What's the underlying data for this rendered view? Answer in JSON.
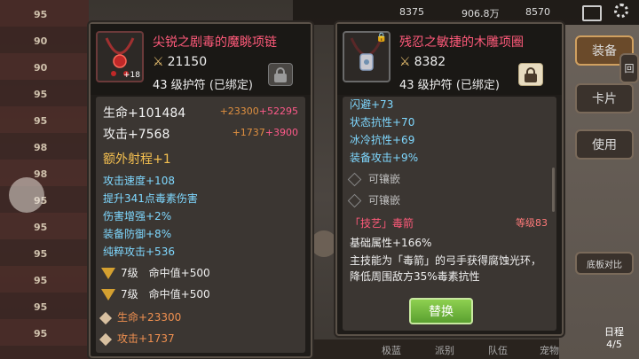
{
  "background": {
    "rank_rows": [
      "95",
      "90",
      "90",
      "95",
      "95",
      "98",
      "98",
      "95",
      "95",
      "95",
      "95",
      "95",
      "95"
    ],
    "top_stats": [
      "8375",
      "906.8万",
      "8570"
    ],
    "right_buttons": [
      "装备",
      "回",
      "卡片",
      "使用",
      "底板对比"
    ],
    "schedule": {
      "label": "日程",
      "progress": "4/5"
    },
    "bottom_tabs": [
      "极蓝",
      "派别",
      "队伍",
      "宠物"
    ]
  },
  "left_item": {
    "name": "尖锐之剧毒的魔眺项链",
    "enhance": "+18",
    "power": "21150",
    "level_text": "43 级护符",
    "bound_text": "(已绑定)",
    "stats": [
      {
        "label": "生命+101484",
        "extra1": "+23300",
        "extra2": "+52295"
      },
      {
        "label": "攻击+7568",
        "extra1": "+1737",
        "extra2": "+3900"
      }
    ],
    "special": "额外射程+1",
    "attrs": [
      "攻击速度+108",
      "提升341点毒素伤害",
      "伤害增强+2%",
      "装备防御+8%",
      "纯粹攻击+536"
    ],
    "gems": [
      {
        "level": "7级",
        "text": "命中值+500"
      },
      {
        "level": "7级",
        "text": "命中值+500"
      }
    ],
    "enhancements": [
      "生命+23300",
      "攻击+1737"
    ]
  },
  "right_item": {
    "name": "残忍之敏捷的木雕项圈",
    "power": "8382",
    "level_text": "43 级护符",
    "bound_text": "(已绑定)",
    "attrs": [
      "闪避+73",
      "状态抗性+70",
      "冰冷抗性+69",
      "装备攻击+9%"
    ],
    "sockets": [
      "可镶嵌",
      "可镶嵌"
    ],
    "skill": {
      "title": "「技艺」毒箭",
      "level": "等级83",
      "lines": [
        "基础属性+166%",
        "主技能为「毒箭」的弓手获得腐蚀光环，降低周围敌方35%毒素抗性"
      ]
    },
    "replace_label": "替换"
  },
  "colors": {
    "name_pink": "#ff5a7a",
    "attr_cyan": "#7fd8ff",
    "gold": "#f5c050",
    "orange": "#e09040",
    "button_green": "#6ab83a"
  }
}
